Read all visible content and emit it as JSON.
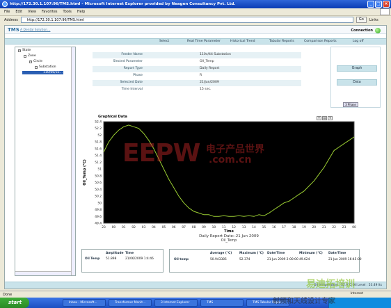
{
  "browser": {
    "title": "http://172.30.1.107:96/TMS.html - Microsoft Internet Explorer provided by Neagen Consultancy Pvt. Ltd.",
    "menu": [
      "File",
      "Edit",
      "View",
      "Favorites",
      "Tools",
      "Help"
    ],
    "address_label": "Address",
    "address": "http://172.30.1.107:96/TMS.html",
    "go_label": "Go",
    "links_label": "Links",
    "status": "Done",
    "zone": "Internet"
  },
  "app": {
    "brand": "TMS",
    "brand_sub": "A Dental Solution...",
    "connection_label": "Connection",
    "nav": [
      "Select",
      "Real Time Parameter",
      "Historical Trend",
      "Tabular Reports",
      "Comparison Reports",
      "Log off"
    ],
    "tree": [
      {
        "label": "State",
        "level": 0
      },
      {
        "label": "Zone",
        "level": 1
      },
      {
        "label": "Circle",
        "level": 2
      },
      {
        "label": "Substation",
        "level": 3
      },
      {
        "label": "110/66/33...",
        "level": 4,
        "selected": true
      }
    ],
    "info": [
      {
        "label": "Feeder Name",
        "value": "110v/44 Substation"
      },
      {
        "label": "Slected Parameter",
        "value": "Oil_Temp"
      },
      {
        "label": "Report Type",
        "value": "Daily Report"
      },
      {
        "label": "Phase",
        "value": "R"
      },
      {
        "label": "Selected Date",
        "value": "21/Jun/2009"
      },
      {
        "label": "Time Interval",
        "value": "15    sec."
      }
    ],
    "side_buttons": [
      "Graph",
      "Data"
    ],
    "small_tool": "3 Phase",
    "amplitude_table": {
      "headers": [
        "Amplitude",
        "Time"
      ],
      "row_label": "Oil Temp",
      "values": [
        "51.898",
        "21/06/2009 1:4:46"
      ]
    },
    "stat_table": {
      "headers": [
        "Average  (°C)",
        "Maximum  (°C)",
        "Date/Time",
        "Minimum  (°C)",
        "Date/Time"
      ],
      "row_label": "Oil temp",
      "values": [
        "50.943385",
        "52.374",
        "21 Jun 2009 2:00:00",
        "49.624",
        "21 Jun 2009 16:45:00"
      ]
    },
    "bottom_status": "Oil temperature : 52.9°C   Oil Level : 53.49 lts"
  },
  "chart_data": {
    "type": "line",
    "title": "Graphical Data",
    "xlabel": "Time",
    "ylabel": "Oil_Temp (°C)",
    "subtitle": "Daily Report Date:-21 Jun 2009",
    "legend": "Oil_Temp",
    "x_ticks": [
      "23",
      "00",
      "01",
      "02",
      "03",
      "04",
      "05",
      "06",
      "07",
      "08",
      "09",
      "10",
      "11",
      "12",
      "13",
      "14",
      "15",
      "16",
      "17",
      "18",
      "19",
      "20",
      "21",
      "22",
      "23",
      "00"
    ],
    "y_ticks": [
      "49.4",
      "49.6",
      "49.8",
      "50",
      "50.2",
      "50.4",
      "50.6",
      "50.8",
      "51",
      "51.2",
      "51.4",
      "51.6",
      "51.8",
      "52",
      "52.2",
      "52.4"
    ],
    "ylim": [
      49.4,
      52.4
    ],
    "line_color": "#9acd32",
    "background": "#000000",
    "series": [
      {
        "name": "Oil_Temp",
        "x": [
          0,
          0.5,
          1,
          1.5,
          2,
          2.5,
          3,
          3.5,
          4,
          4.5,
          5,
          5.5,
          6,
          6.5,
          7,
          7.5,
          8,
          8.5,
          9,
          9.5,
          10,
          10.5,
          11,
          11.5,
          12,
          12.5,
          13,
          13.5,
          14,
          14.5,
          15,
          15.5,
          16,
          16.5,
          17,
          17.5,
          18,
          18.5,
          19,
          19.5,
          20,
          20.5,
          21,
          21.5,
          22,
          22.5,
          23,
          23.5,
          24,
          24.5,
          25
        ],
        "values": [
          51.5,
          51.8,
          52.0,
          52.15,
          52.25,
          52.3,
          52.25,
          52.2,
          52.05,
          51.85,
          51.6,
          51.3,
          51.0,
          50.7,
          50.45,
          50.2,
          50.0,
          49.85,
          49.75,
          49.7,
          49.65,
          49.65,
          49.6,
          49.6,
          49.62,
          49.6,
          49.6,
          49.62,
          49.6,
          49.62,
          49.6,
          49.65,
          49.62,
          49.7,
          49.8,
          49.9,
          50.0,
          50.05,
          50.15,
          50.25,
          50.35,
          50.5,
          50.65,
          50.85,
          51.05,
          51.3,
          51.55,
          51.65,
          51.75,
          51.85,
          51.95
        ]
      }
    ]
  },
  "watermark": {
    "eepw": "EEPW",
    "cn": "电子产品世界",
    "com": ".com.cn",
    "br": "易迪拓培训",
    "br2": "射频和天线设计专家"
  },
  "taskbar": {
    "start": "start",
    "tasks": [
      "Inbox - Microsoft...",
      "Transformer Monit...",
      "3 Internet Explorer",
      "TMS",
      "TMS Tabular Repor..."
    ]
  }
}
